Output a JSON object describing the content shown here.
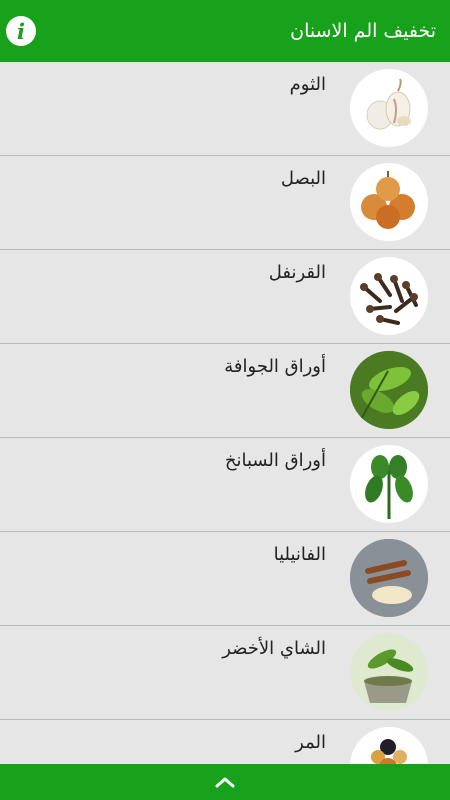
{
  "app_bar": {
    "title": "تخفيف الم الاسنان",
    "info_icon": "i"
  },
  "items": [
    {
      "label": "الثوم",
      "icon": "garlic-image"
    },
    {
      "label": "البصل",
      "icon": "onion-image"
    },
    {
      "label": "القرنفل",
      "icon": "cloves-image"
    },
    {
      "label": "أوراق الجوافة",
      "icon": "guava-leaves-image"
    },
    {
      "label": "أوراق السبانخ",
      "icon": "spinach-leaves-image"
    },
    {
      "label": "الفانيليا",
      "icon": "vanilla-image"
    },
    {
      "label": "الشاي الأخضر",
      "icon": "green-tea-image"
    },
    {
      "label": "المر",
      "icon": "myrrh-image"
    }
  ],
  "colors": {
    "accent": "#18a21b",
    "background": "#e6e6e6",
    "divider": "#b9b9b9"
  }
}
